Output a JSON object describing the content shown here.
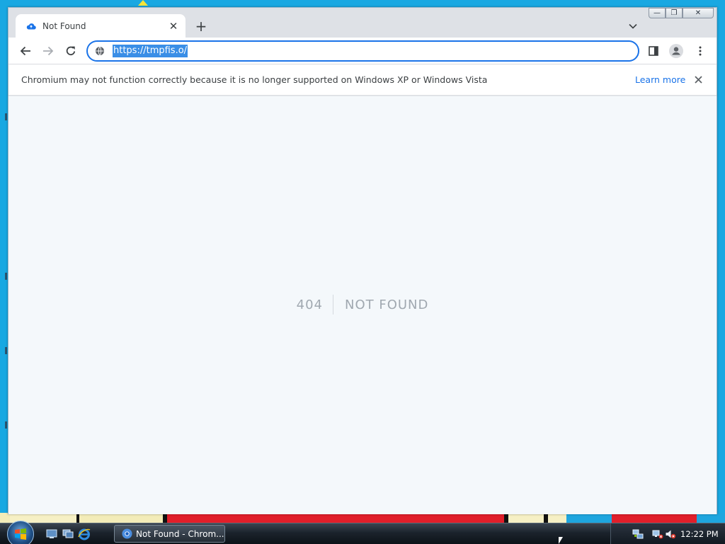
{
  "browser": {
    "tab": {
      "title": "Not Found",
      "close_glyph": "✕"
    },
    "new_tab_glyph": "+",
    "address": {
      "url": "https://tmpfis.o/"
    },
    "infobar": {
      "message": "Chromium may not function correctly because it is no longer supported on Windows XP or Windows Vista",
      "learn_more": "Learn more",
      "close_glyph": "✕"
    },
    "window_controls": {
      "minimize": "—",
      "restore": "❐",
      "close": "✕"
    }
  },
  "page": {
    "status_code": "404",
    "status_text": "NOT FOUND"
  },
  "taskbar": {
    "task_label": "Not Found - Chrom...",
    "clock": "12:22 PM"
  },
  "colors": {
    "accent": "#1a73e8",
    "desktop": "#19a8e2",
    "page_bg": "#f4f8fb"
  }
}
